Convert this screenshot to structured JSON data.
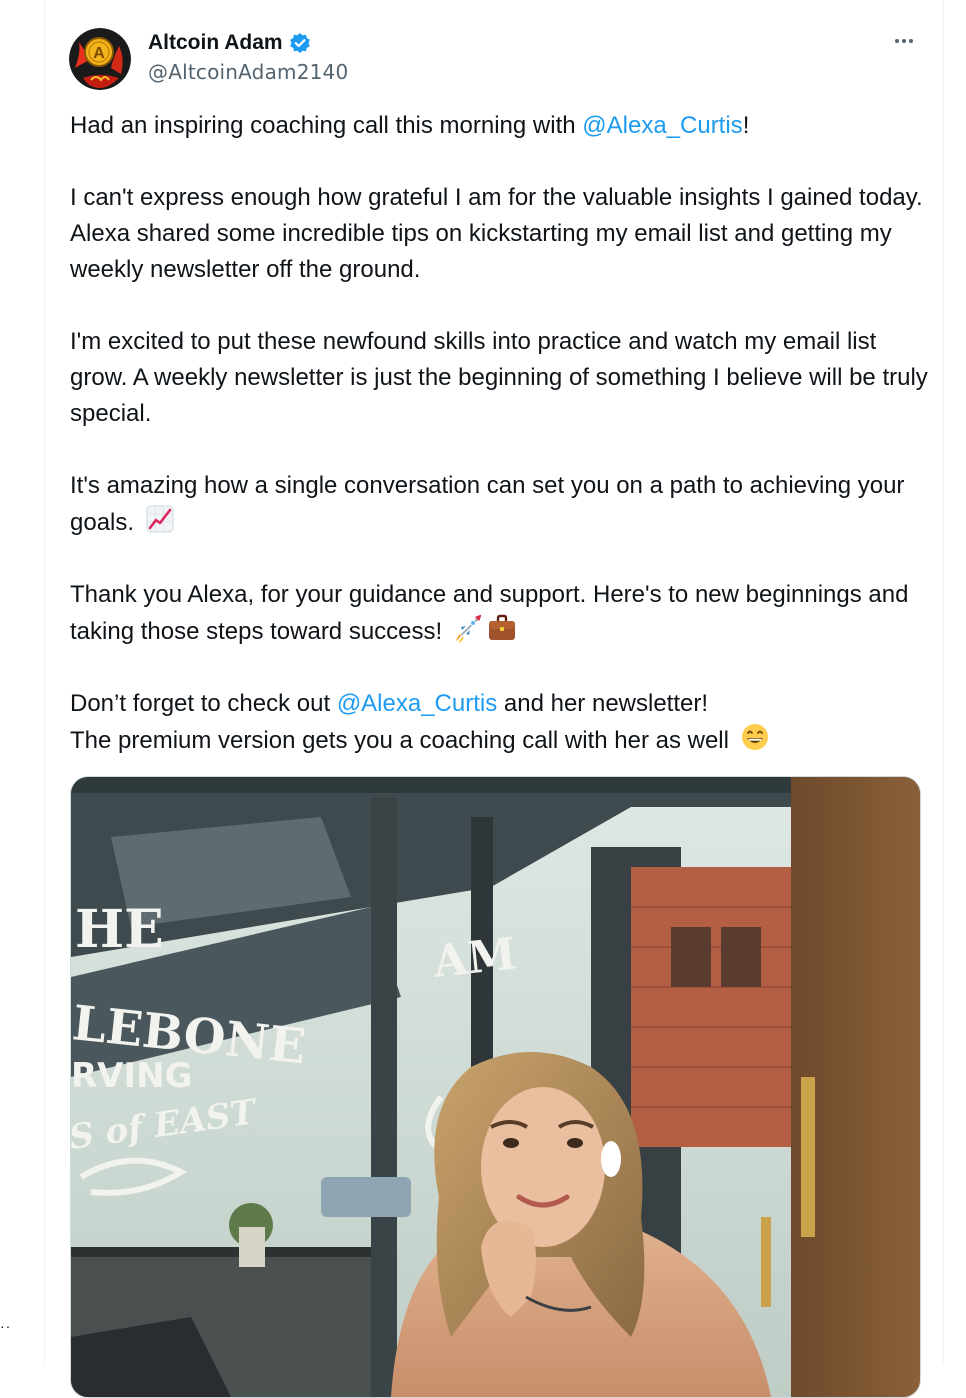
{
  "author": {
    "display_name": "Altcoin Adam",
    "handle": "@AltcoinAdam2140",
    "avatar_letter": "A",
    "verified": true
  },
  "tweet": {
    "p1_pre": "Had an inspiring coaching call this morning with ",
    "p1_mention": "@Alexa_Curtis",
    "p1_post": "!",
    "p2": "I can't express enough how grateful I am for the valuable insights I gained today. Alexa shared some incredible tips on kickstarting my email list and getting my weekly newsletter off the ground.",
    "p3": "I'm excited to put these newfound skills into practice and watch my email list grow. A weekly newsletter is just the beginning of something I believe will be truly special.",
    "p4": "It's amazing how a single conversation can set you on a path to achieving your goals.",
    "p5": "Thank you Alexa, for your guidance and support. Here's to new beginnings and taking those steps toward success!",
    "p6_pre": "Don’t forget to check out ",
    "p6_mention": "@Alexa_Curtis",
    "p6_post": " and her newsletter!",
    "p7": "The premium version gets you a coaching call with her as well"
  },
  "media": {
    "window_lettering": [
      "HE",
      "LEBONE",
      "RVING",
      "S of EAST"
    ],
    "door_lettering": "AM"
  },
  "icons": {
    "more": "more-horizontal-icon",
    "verified": "verified-badge-icon",
    "chart": "chart-increasing-emoji",
    "rocket": "rocket-emoji",
    "briefcase": "briefcase-emoji",
    "grin": "grinning-face-emoji"
  },
  "colors": {
    "link": "#1d9bf0",
    "verified": "#1d9bf0",
    "secondary_text": "#536471"
  },
  "edge_text": "··"
}
